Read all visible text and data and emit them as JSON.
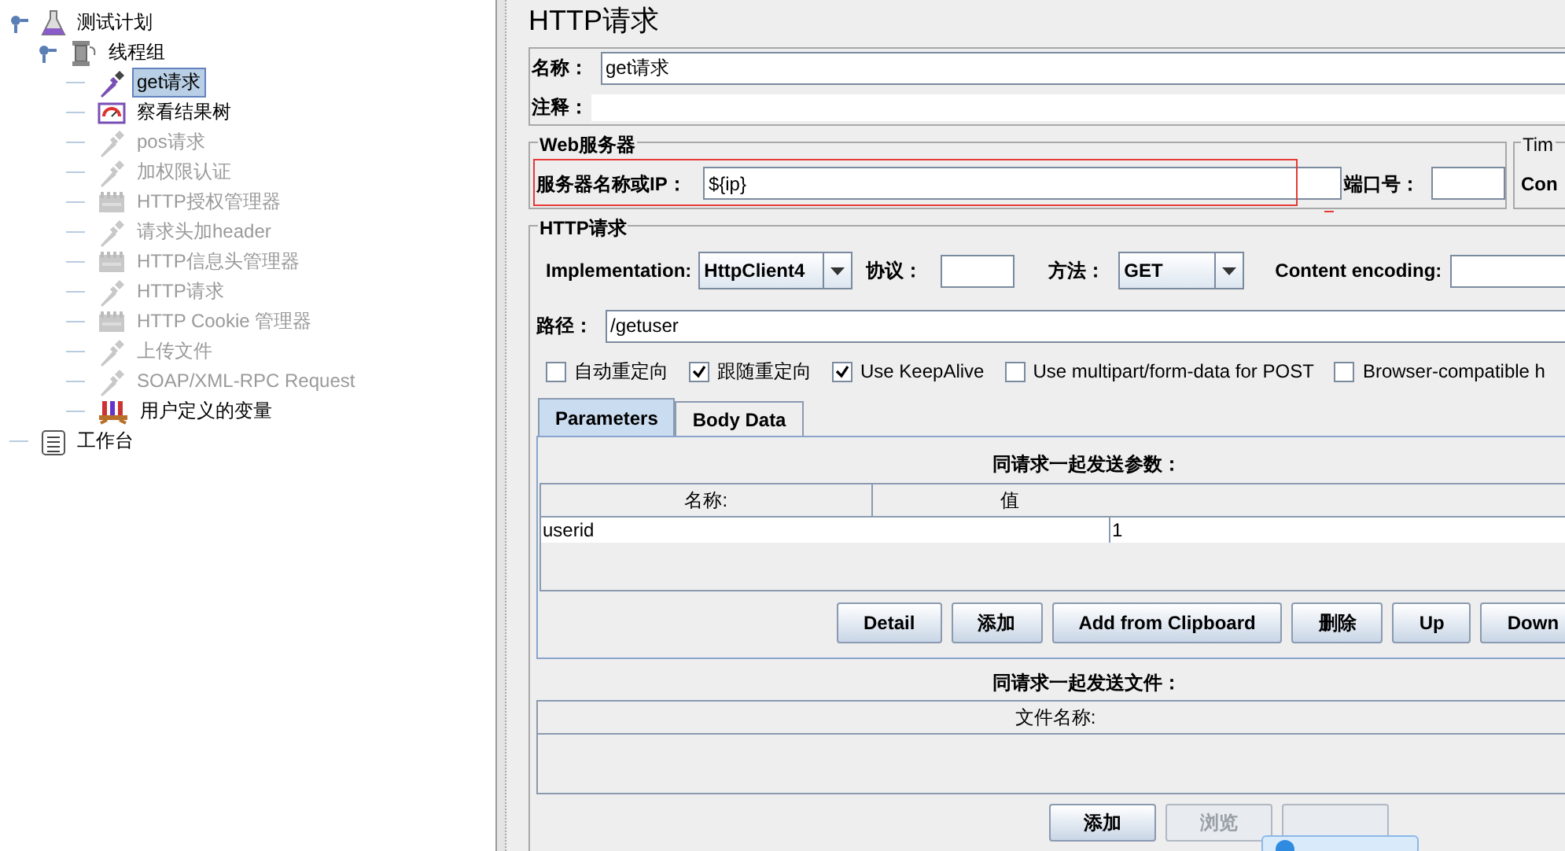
{
  "tree": [
    {
      "label": "测试计划",
      "kind": "plan",
      "enabled": true,
      "selected": false,
      "expanded": true,
      "children": [
        {
          "label": "线程组",
          "kind": "thread_group",
          "enabled": true,
          "selected": false,
          "expanded": true,
          "children": [
            {
              "label": "get请求",
              "kind": "sampler",
              "enabled": true,
              "selected": true
            },
            {
              "label": "察看结果树",
              "kind": "listener",
              "enabled": true,
              "selected": false
            },
            {
              "label": "pos请求",
              "kind": "sampler",
              "enabled": false,
              "selected": false
            },
            {
              "label": "加权限认证",
              "kind": "sampler",
              "enabled": false,
              "selected": false
            },
            {
              "label": "HTTP授权管理器",
              "kind": "config",
              "enabled": false,
              "selected": false
            },
            {
              "label": "请求头加header",
              "kind": "sampler",
              "enabled": false,
              "selected": false
            },
            {
              "label": "HTTP信息头管理器",
              "kind": "config",
              "enabled": false,
              "selected": false
            },
            {
              "label": "HTTP请求",
              "kind": "sampler",
              "enabled": false,
              "selected": false
            },
            {
              "label": "HTTP Cookie 管理器",
              "kind": "config",
              "enabled": false,
              "selected": false
            },
            {
              "label": "上传文件",
              "kind": "sampler",
              "enabled": false,
              "selected": false
            },
            {
              "label": "SOAP/XML-RPC Request",
              "kind": "sampler",
              "enabled": false,
              "selected": false
            },
            {
              "label": "用户定义的变量",
              "kind": "variables",
              "enabled": true,
              "selected": false
            }
          ]
        }
      ]
    },
    {
      "label": "工作台",
      "kind": "workbench",
      "enabled": true,
      "selected": false
    }
  ],
  "title": "HTTP请求",
  "name_field": {
    "label": "名称：",
    "value": "get请求"
  },
  "comment_field": {
    "label": "注释："
  },
  "web_server": {
    "legend": "Web服务器",
    "server_label": "服务器名称或IP：",
    "server_value": "${ip}",
    "port_label": "端口号："
  },
  "timeouts": {
    "legend": "Tim",
    "label": "Con"
  },
  "http_request": {
    "legend": "HTTP请求",
    "implementation": {
      "label": "Implementation:",
      "value": "HttpClient4"
    },
    "protocol_label": "协议：",
    "method": {
      "label": "方法：",
      "value": "GET"
    },
    "encoding_label": "Content encoding:",
    "path": {
      "label": "路径：",
      "value": "/getuser"
    },
    "options": [
      {
        "label": "自动重定向",
        "checked": false
      },
      {
        "label": "跟随重定向",
        "checked": true
      },
      {
        "label": "Use KeepAlive",
        "checked": true
      },
      {
        "label": "Use multipart/form-data for POST",
        "checked": false
      },
      {
        "label": "Browser-compatible h",
        "checked": false
      }
    ],
    "tabs": [
      {
        "label": "Parameters",
        "selected": true
      },
      {
        "label": "Body Data",
        "selected": false
      }
    ],
    "parameters": {
      "caption": "同请求一起发送参数：",
      "columns": [
        "名称:",
        "值"
      ],
      "rows": [
        [
          "userid",
          "1"
        ]
      ],
      "buttons": [
        "Detail",
        "添加",
        "Add from Clipboard",
        "删除",
        "Up",
        "Down"
      ]
    },
    "files": {
      "caption": "同请求一起发送文件：",
      "columns": [
        "文件名称:"
      ],
      "buttons": [
        {
          "label": "添加",
          "disabled": false
        },
        {
          "label": "浏览",
          "disabled": true
        },
        {
          "disabled": true
        }
      ]
    }
  }
}
